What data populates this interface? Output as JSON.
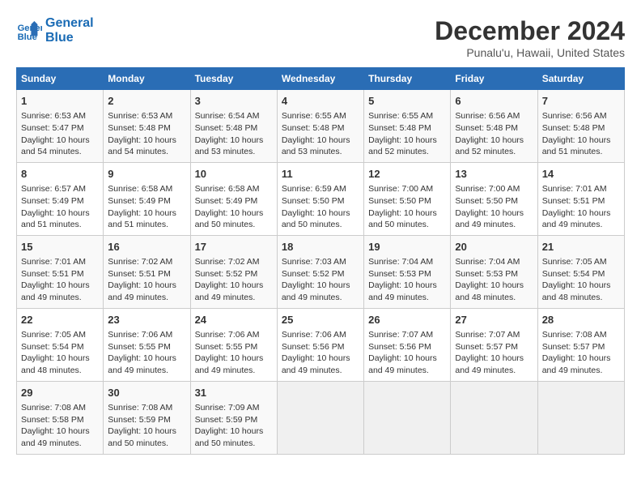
{
  "logo": {
    "line1": "General",
    "line2": "Blue"
  },
  "title": "December 2024",
  "subtitle": "Punalu'u, Hawaii, United States",
  "days_of_week": [
    "Sunday",
    "Monday",
    "Tuesday",
    "Wednesday",
    "Thursday",
    "Friday",
    "Saturday"
  ],
  "weeks": [
    [
      {
        "day": 1,
        "sunrise": "6:53 AM",
        "sunset": "5:47 PM",
        "daylight": "10 hours and 54 minutes."
      },
      {
        "day": 2,
        "sunrise": "6:53 AM",
        "sunset": "5:48 PM",
        "daylight": "10 hours and 54 minutes."
      },
      {
        "day": 3,
        "sunrise": "6:54 AM",
        "sunset": "5:48 PM",
        "daylight": "10 hours and 53 minutes."
      },
      {
        "day": 4,
        "sunrise": "6:55 AM",
        "sunset": "5:48 PM",
        "daylight": "10 hours and 53 minutes."
      },
      {
        "day": 5,
        "sunrise": "6:55 AM",
        "sunset": "5:48 PM",
        "daylight": "10 hours and 52 minutes."
      },
      {
        "day": 6,
        "sunrise": "6:56 AM",
        "sunset": "5:48 PM",
        "daylight": "10 hours and 52 minutes."
      },
      {
        "day": 7,
        "sunrise": "6:56 AM",
        "sunset": "5:48 PM",
        "daylight": "10 hours and 51 minutes."
      }
    ],
    [
      {
        "day": 8,
        "sunrise": "6:57 AM",
        "sunset": "5:49 PM",
        "daylight": "10 hours and 51 minutes."
      },
      {
        "day": 9,
        "sunrise": "6:58 AM",
        "sunset": "5:49 PM",
        "daylight": "10 hours and 51 minutes."
      },
      {
        "day": 10,
        "sunrise": "6:58 AM",
        "sunset": "5:49 PM",
        "daylight": "10 hours and 50 minutes."
      },
      {
        "day": 11,
        "sunrise": "6:59 AM",
        "sunset": "5:50 PM",
        "daylight": "10 hours and 50 minutes."
      },
      {
        "day": 12,
        "sunrise": "7:00 AM",
        "sunset": "5:50 PM",
        "daylight": "10 hours and 50 minutes."
      },
      {
        "day": 13,
        "sunrise": "7:00 AM",
        "sunset": "5:50 PM",
        "daylight": "10 hours and 49 minutes."
      },
      {
        "day": 14,
        "sunrise": "7:01 AM",
        "sunset": "5:51 PM",
        "daylight": "10 hours and 49 minutes."
      }
    ],
    [
      {
        "day": 15,
        "sunrise": "7:01 AM",
        "sunset": "5:51 PM",
        "daylight": "10 hours and 49 minutes."
      },
      {
        "day": 16,
        "sunrise": "7:02 AM",
        "sunset": "5:51 PM",
        "daylight": "10 hours and 49 minutes."
      },
      {
        "day": 17,
        "sunrise": "7:02 AM",
        "sunset": "5:52 PM",
        "daylight": "10 hours and 49 minutes."
      },
      {
        "day": 18,
        "sunrise": "7:03 AM",
        "sunset": "5:52 PM",
        "daylight": "10 hours and 49 minutes."
      },
      {
        "day": 19,
        "sunrise": "7:04 AM",
        "sunset": "5:53 PM",
        "daylight": "10 hours and 49 minutes."
      },
      {
        "day": 20,
        "sunrise": "7:04 AM",
        "sunset": "5:53 PM",
        "daylight": "10 hours and 48 minutes."
      },
      {
        "day": 21,
        "sunrise": "7:05 AM",
        "sunset": "5:54 PM",
        "daylight": "10 hours and 48 minutes."
      }
    ],
    [
      {
        "day": 22,
        "sunrise": "7:05 AM",
        "sunset": "5:54 PM",
        "daylight": "10 hours and 48 minutes."
      },
      {
        "day": 23,
        "sunrise": "7:06 AM",
        "sunset": "5:55 PM",
        "daylight": "10 hours and 49 minutes."
      },
      {
        "day": 24,
        "sunrise": "7:06 AM",
        "sunset": "5:55 PM",
        "daylight": "10 hours and 49 minutes."
      },
      {
        "day": 25,
        "sunrise": "7:06 AM",
        "sunset": "5:56 PM",
        "daylight": "10 hours and 49 minutes."
      },
      {
        "day": 26,
        "sunrise": "7:07 AM",
        "sunset": "5:56 PM",
        "daylight": "10 hours and 49 minutes."
      },
      {
        "day": 27,
        "sunrise": "7:07 AM",
        "sunset": "5:57 PM",
        "daylight": "10 hours and 49 minutes."
      },
      {
        "day": 28,
        "sunrise": "7:08 AM",
        "sunset": "5:57 PM",
        "daylight": "10 hours and 49 minutes."
      }
    ],
    [
      {
        "day": 29,
        "sunrise": "7:08 AM",
        "sunset": "5:58 PM",
        "daylight": "10 hours and 49 minutes."
      },
      {
        "day": 30,
        "sunrise": "7:08 AM",
        "sunset": "5:59 PM",
        "daylight": "10 hours and 50 minutes."
      },
      {
        "day": 31,
        "sunrise": "7:09 AM",
        "sunset": "5:59 PM",
        "daylight": "10 hours and 50 minutes."
      },
      null,
      null,
      null,
      null
    ]
  ],
  "labels": {
    "sunrise": "Sunrise:",
    "sunset": "Sunset:",
    "daylight": "Daylight:"
  }
}
